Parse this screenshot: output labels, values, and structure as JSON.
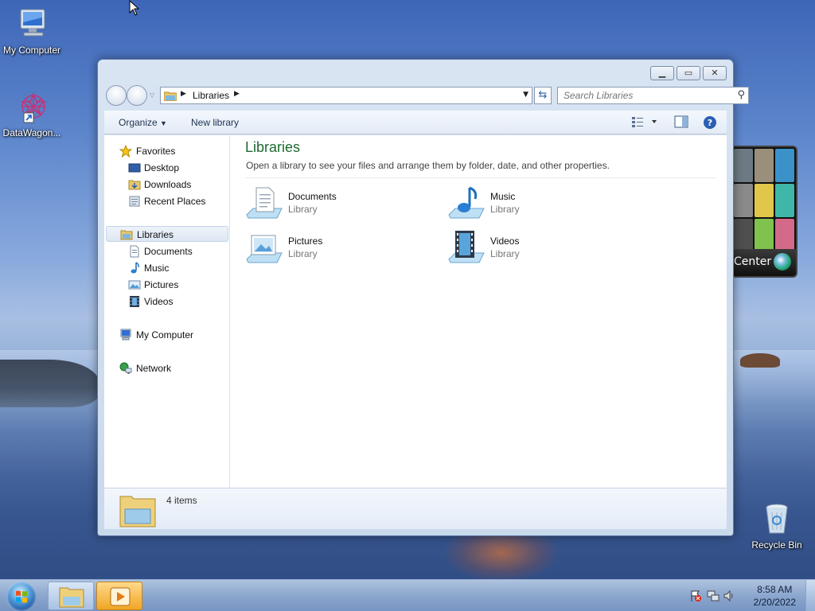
{
  "desktop": {
    "icons": [
      {
        "label": "My Computer",
        "icon": "computer-icon"
      },
      {
        "label": "DataWagon...",
        "icon": "datawagon-shortcut-icon"
      },
      {
        "label": "Recycle Bin",
        "icon": "recycle-bin-icon"
      }
    ],
    "gadget": {
      "label": "Center"
    }
  },
  "window": {
    "address": {
      "crumb": "Libraries"
    },
    "search": {
      "placeholder": "Search Libraries"
    },
    "toolbar": {
      "organize": "Organize",
      "new_library": "New library"
    },
    "nav": {
      "favorites": "Favorites",
      "desktop": "Desktop",
      "downloads": "Downloads",
      "recent_places": "Recent Places",
      "libraries": "Libraries",
      "documents": "Documents",
      "music": "Music",
      "pictures": "Pictures",
      "videos": "Videos",
      "my_computer": "My Computer",
      "network": "Network"
    },
    "content": {
      "title": "Libraries",
      "subtitle": "Open a library to see your files and arrange them by folder, date, and other properties.",
      "items": [
        {
          "name": "Documents",
          "kind": "Library",
          "icon": "documents-library-icon"
        },
        {
          "name": "Music",
          "kind": "Library",
          "icon": "music-library-icon"
        },
        {
          "name": "Pictures",
          "kind": "Library",
          "icon": "pictures-library-icon"
        },
        {
          "name": "Videos",
          "kind": "Library",
          "icon": "videos-library-icon"
        }
      ]
    },
    "details": {
      "count": "4 items"
    }
  },
  "taskbar": {
    "clock": {
      "time": "8:58 AM",
      "date": "2/20/2022"
    }
  },
  "colors": {
    "title_green": "#1c6b30",
    "selected_nav": "#dde7f4"
  }
}
